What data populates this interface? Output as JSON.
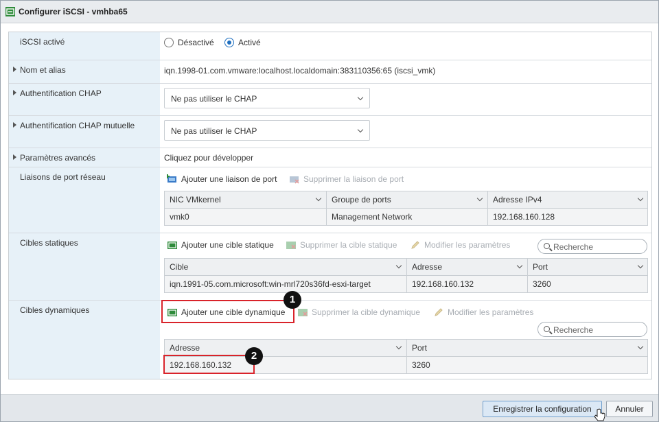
{
  "window": {
    "title": "Configurer iSCSI - vmhba65",
    "icon": "iscsi-adapter-icon"
  },
  "rows": {
    "iscsi_enabled": {
      "label": "iSCSI activé",
      "options": [
        "Désactivé",
        "Activé"
      ],
      "selected": "Activé"
    },
    "name_alias": {
      "label": "Nom et alias",
      "value": "iqn.1998-01.com.vmware:localhost.localdomain:383110356:65 (iscsi_vmk)"
    },
    "chap": {
      "label": "Authentification CHAP",
      "value": "Ne pas utiliser le CHAP"
    },
    "mutual_chap": {
      "label": "Authentification CHAP mutuelle",
      "value": "Ne pas utiliser le CHAP"
    },
    "advanced": {
      "label": "Paramètres avancés",
      "value": "Cliquez pour développer"
    },
    "port_bindings": {
      "label": "Liaisons de port réseau",
      "add_label": "Ajouter une liaison de port",
      "remove_label": "Supprimer la liaison de port",
      "columns": [
        "NIC VMkernel",
        "Groupe de ports",
        "Adresse IPv4"
      ],
      "rows": [
        [
          "vmk0",
          "Management Network",
          "192.168.160.128"
        ]
      ]
    },
    "static_targets": {
      "label": "Cibles statiques",
      "add_label": "Ajouter une cible statique",
      "remove_label": "Supprimer la cible statique",
      "edit_label": "Modifier les paramètres",
      "search_placeholder": "Recherche",
      "columns": [
        "Cible",
        "Adresse",
        "Port"
      ],
      "rows": [
        [
          "iqn.1991-05.com.microsoft:win-mrl720s36fd-esxi-target",
          "192.168.160.132",
          "3260"
        ]
      ]
    },
    "dynamic_targets": {
      "label": "Cibles dynamiques",
      "add_label": "Ajouter une cible dynamique",
      "remove_label": "Supprimer la cible dynamique",
      "edit_label": "Modifier les paramètres",
      "search_placeholder": "Recherche",
      "columns": [
        "Adresse",
        "Port"
      ],
      "rows": [
        [
          "192.168.160.132",
          "3260"
        ]
      ]
    }
  },
  "annotations": [
    "1",
    "2"
  ],
  "footer": {
    "save_label": "Enregistrer la configuration",
    "cancel_label": "Annuler"
  },
  "colors": {
    "highlight": "#d9232a",
    "label_bg": "#e7f1f8",
    "accent": "#1f6fbf"
  }
}
